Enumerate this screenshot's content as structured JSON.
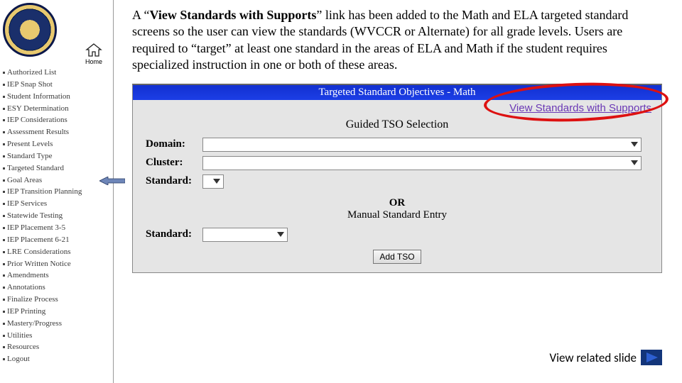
{
  "sidebar": {
    "home_label": "Home",
    "items": [
      "Authorized List",
      "IEP Snap Shot",
      "Student Information",
      "ESY Determination",
      "IEP Considerations",
      "Assessment Results",
      "Present Levels",
      "Standard Type",
      "Targeted Standard",
      "Goal Areas",
      "IEP Transition Planning",
      "IEP Services",
      "Statewide Testing",
      "IEP Placement 3-5",
      "IEP Placement 6-21",
      "LRE Considerations",
      "Prior Written Notice",
      "Amendments",
      "Annotations",
      "Finalize Process",
      "IEP Printing",
      "Mastery/Progress",
      "Utilities",
      "Resources",
      "Logout"
    ]
  },
  "intro": {
    "pre": "A “",
    "bold": "View Standards with Supports",
    "post": "” link has been added to the Math and ELA targeted standard screens so the user can view the standards (WVCCR or Alternate) for all grade levels.  Users are required to “target” at least one standard in the areas of ELA and Math if the student requires specialized instruction in one or both of these areas."
  },
  "shot": {
    "bluebar": "Targeted Standard Objectives - Math",
    "link": "View Standards with Supports",
    "section1": "Guided TSO Selection",
    "labels": {
      "domain": "Domain:",
      "cluster": "Cluster:",
      "standard": "Standard:"
    },
    "or": "OR",
    "manual": "Manual Standard Entry",
    "labels2": {
      "standard": "Standard:"
    },
    "button": "Add TSO"
  },
  "footer": {
    "text": "View related slide"
  }
}
